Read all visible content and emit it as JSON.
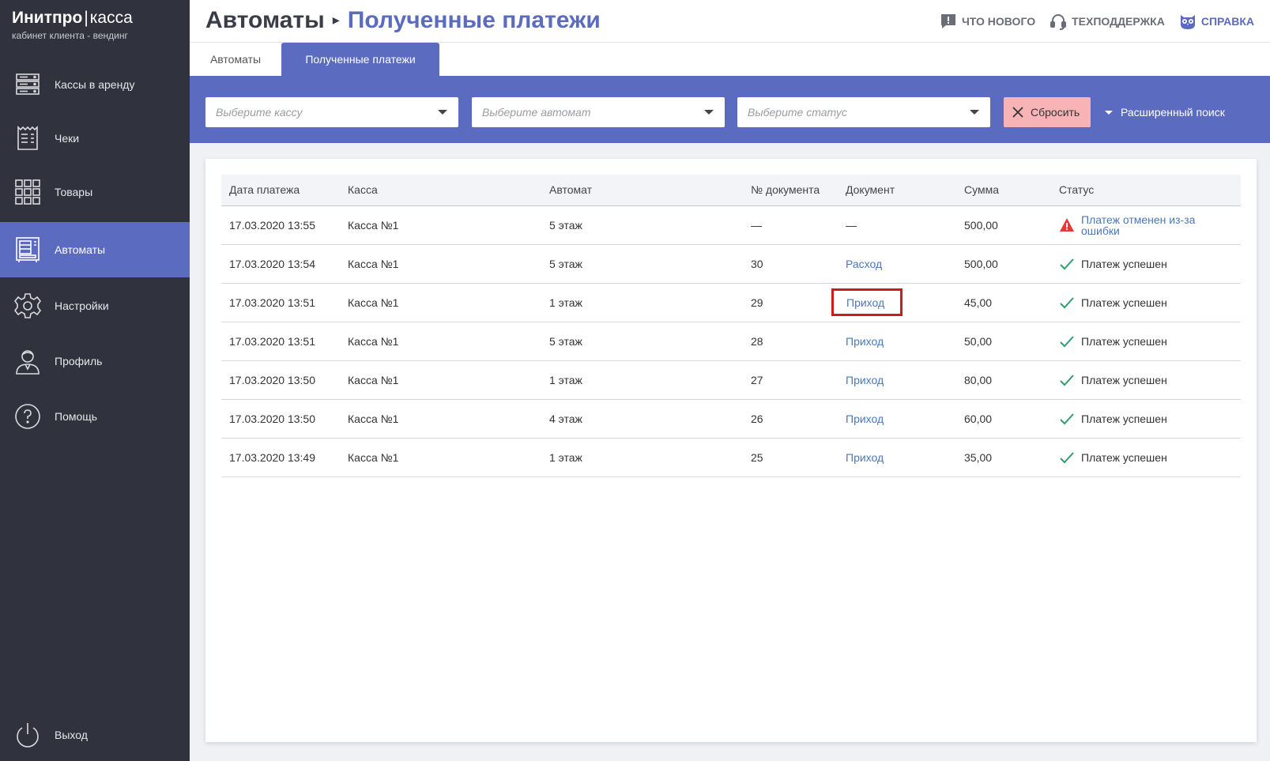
{
  "brand": {
    "name_bold": "Инитпро",
    "separator": "|",
    "name_light": "касса",
    "subtitle": "кабинет клиента - вендинг"
  },
  "sidebar": {
    "items": [
      {
        "label": "Кассы в аренду",
        "icon": "server-icon"
      },
      {
        "label": "Чеки",
        "icon": "receipt-icon"
      },
      {
        "label": "Товары",
        "icon": "grid-icon"
      },
      {
        "label": "Автоматы",
        "icon": "vending-machine-icon",
        "active": true
      },
      {
        "label": "Настройки",
        "icon": "gear-icon"
      },
      {
        "label": "Профиль",
        "icon": "user-icon"
      },
      {
        "label": "Помощь",
        "icon": "help-icon"
      }
    ],
    "logout": {
      "label": "Выход",
      "icon": "power-icon"
    }
  },
  "header": {
    "breadcrumb_root": "Автоматы",
    "breadcrumb_current": "Полученные платежи",
    "links": {
      "whats_new": "ЧТО НОВОГО",
      "support": "ТЕХПОДДЕРЖКА",
      "help": "СПРАВКА"
    }
  },
  "tabs": [
    {
      "label": "Автоматы"
    },
    {
      "label": "Полученные платежи",
      "active": true
    }
  ],
  "filters": {
    "kassa_placeholder": "Выберите кассу",
    "automat_placeholder": "Выберите автомат",
    "status_placeholder": "Выберите статус",
    "reset_label": "Сбросить",
    "advanced_label": "Расширенный поиск"
  },
  "table": {
    "headers": {
      "date": "Дата платежа",
      "kassa": "Касса",
      "automat": "Автомат",
      "doc_no": "№ документа",
      "doc": "Документ",
      "sum": "Сумма",
      "status": "Статус"
    },
    "rows": [
      {
        "date": "17.03.2020 13:55",
        "kassa": "Касса №1",
        "automat": "5 этаж",
        "doc_no": "—",
        "doc": "—",
        "sum": "500,00",
        "status": "Платеж отменен из-за ошибки"
      },
      {
        "date": "17.03.2020 13:54",
        "kassa": "Касса №1",
        "automat": "5 этаж",
        "doc_no": "30",
        "doc": "Расход",
        "sum": "500,00",
        "status": "Платеж успешен"
      },
      {
        "date": "17.03.2020 13:51",
        "kassa": "Касса №1",
        "automat": "1 этаж",
        "doc_no": "29",
        "doc": "Приход",
        "sum": "45,00",
        "status": "Платеж успешен"
      },
      {
        "date": "17.03.2020 13:51",
        "kassa": "Касса №1",
        "automat": "5 этаж",
        "doc_no": "28",
        "doc": "Приход",
        "sum": "50,00",
        "status": "Платеж успешен"
      },
      {
        "date": "17.03.2020 13:50",
        "kassa": "Касса №1",
        "automat": "1 этаж",
        "doc_no": "27",
        "doc": "Приход",
        "sum": "80,00",
        "status": "Платеж успешен"
      },
      {
        "date": "17.03.2020 13:50",
        "kassa": "Касса №1",
        "automat": "4 этаж",
        "doc_no": "26",
        "doc": "Приход",
        "sum": "60,00",
        "status": "Платеж успешен"
      },
      {
        "date": "17.03.2020 13:49",
        "kassa": "Касса №1",
        "automat": "1 этаж",
        "doc_no": "25",
        "doc": "Приход",
        "sum": "35,00",
        "status": "Платеж успешен"
      }
    ]
  },
  "colors": {
    "sidebar_bg": "#30333d",
    "accent": "#5b6bbf",
    "link": "#4a78b8",
    "reset_bg": "#f7b3b6",
    "success": "#2e9e6b",
    "error": "#e53935",
    "highlight": "#cc1b1b"
  }
}
